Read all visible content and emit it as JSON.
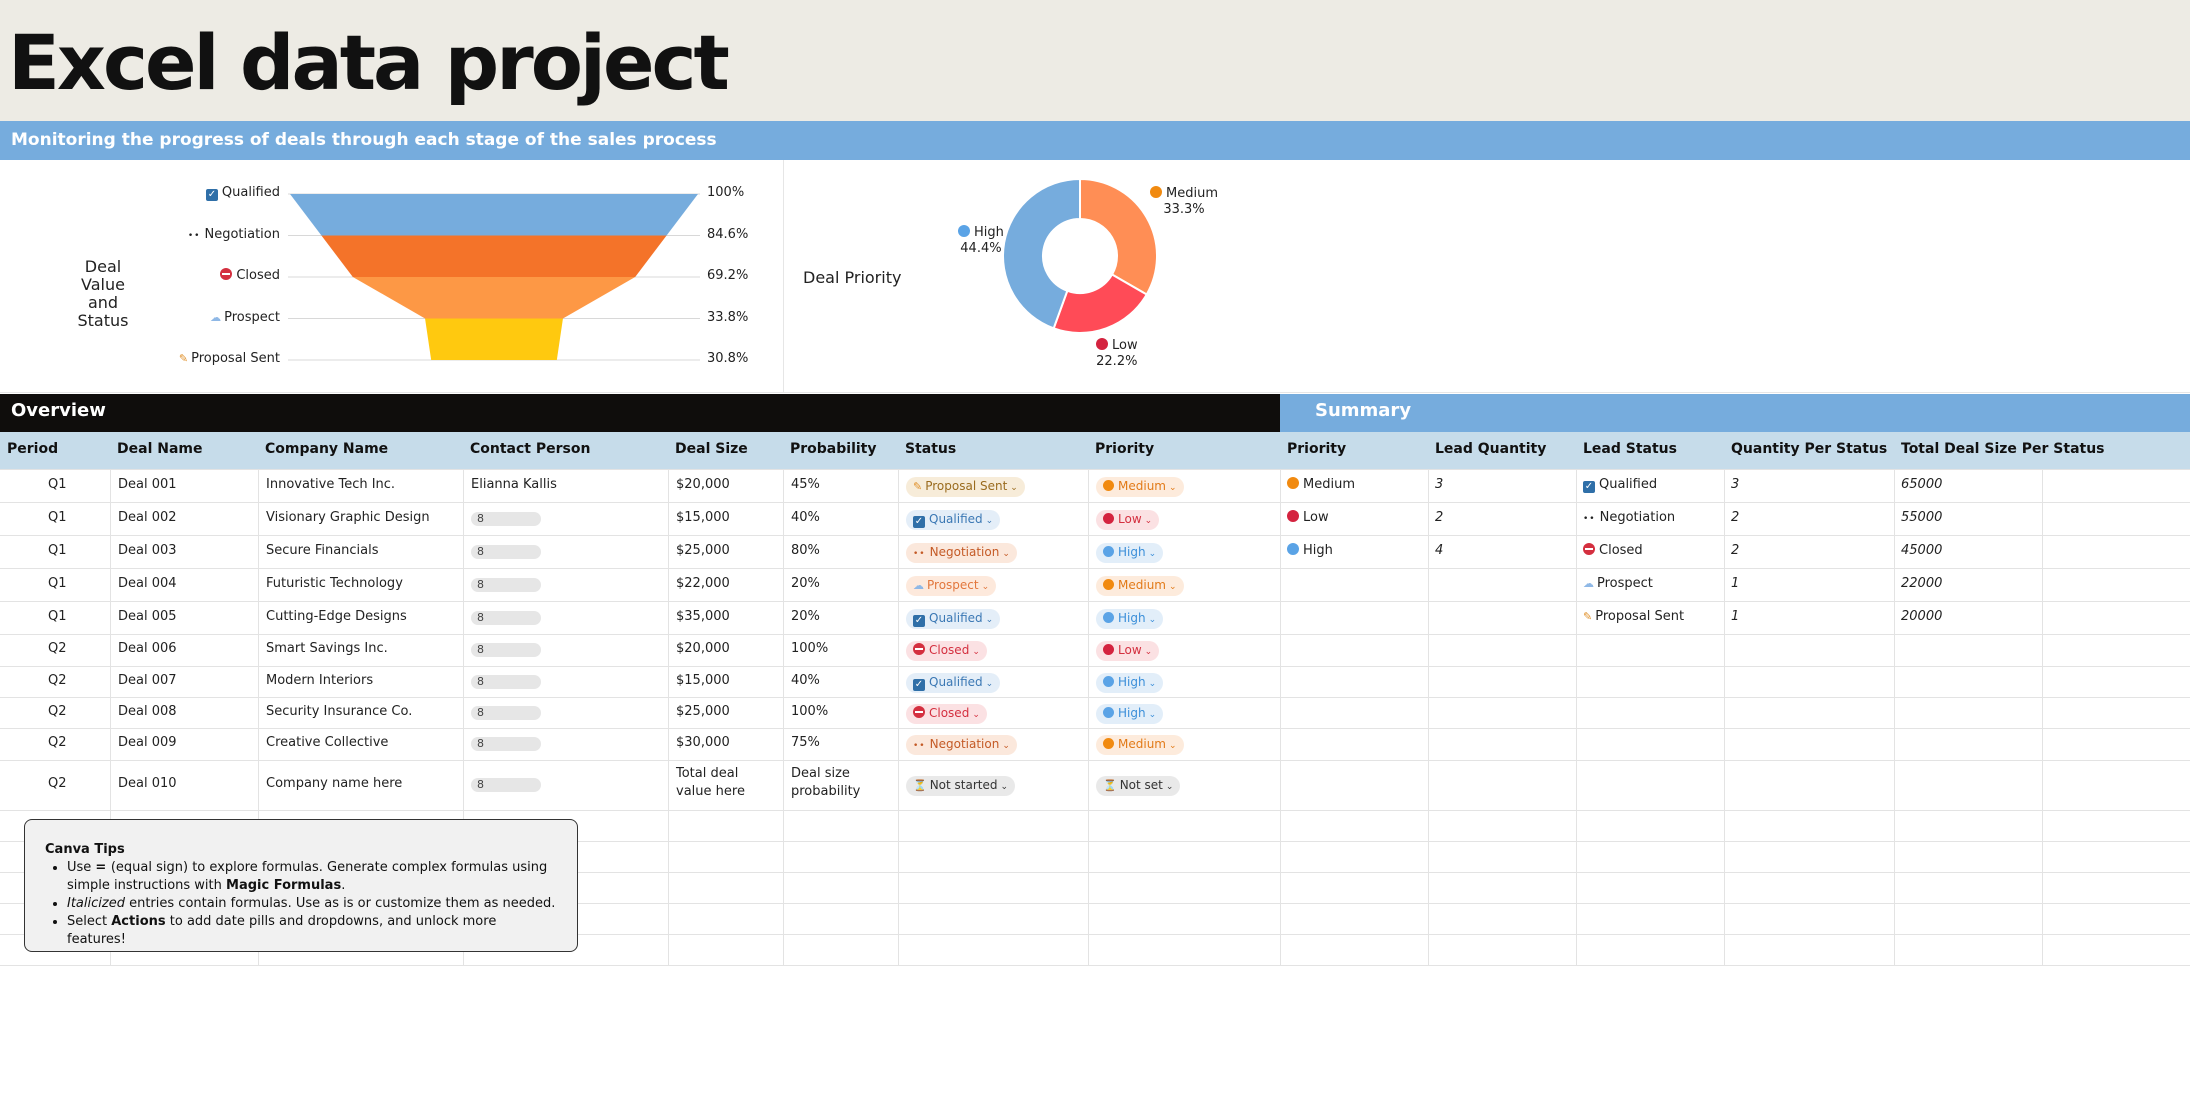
{
  "title": "Excel data project",
  "subtitle": "Monitoring the progress of deals through each stage of the sales process",
  "funnel": {
    "title_line1": "Deal Value",
    "title_line2": "and Status",
    "stages": [
      {
        "label": "Qualified",
        "pct": "100%",
        "color": "#76acdd",
        "icon": "check-icon",
        "value": 100
      },
      {
        "label": "Negotiation",
        "pct": "84.6%",
        "color": "#f47329",
        "icon": "eyes-icon",
        "value": 84.6
      },
      {
        "label": "Closed",
        "pct": "69.2%",
        "color": "#fd9845",
        "icon": "closed-icon",
        "value": 69.2
      },
      {
        "label": "Prospect",
        "pct": "33.8%",
        "color": "#ffc90f",
        "icon": "crystal-ball-icon",
        "value": 33.8
      },
      {
        "label": "Proposal Sent",
        "pct": "30.8%",
        "color": "#ffc90f",
        "icon": "pencil-icon",
        "value": 30.8
      }
    ]
  },
  "donut": {
    "title": "Deal Priority",
    "slices": [
      {
        "label": "Medium",
        "pct": "33.3%",
        "value": 33.3,
        "color": "#ff8e55",
        "dot": "#f18a10"
      },
      {
        "label": "Low",
        "pct": "22.2%",
        "value": 22.2,
        "color": "#ff4b57",
        "dot": "#d4233f"
      },
      {
        "label": "High",
        "pct": "44.4%",
        "value": 44.4,
        "color": "#76acdd",
        "dot": "#5aa3e6"
      }
    ]
  },
  "overview": {
    "title": "Overview",
    "columns": [
      "Period",
      "Deal Name",
      "Company Name",
      "Contact Person",
      "Deal Size",
      "Probability",
      "Status",
      "Priority"
    ],
    "rows": [
      {
        "period": "Q1",
        "deal": "Deal 001",
        "company": "Innovative Tech Inc.",
        "contact": "Elianna Kallis",
        "size": "$20,000",
        "prob": "45%",
        "status": "Proposal Sent",
        "status_kind": "proposal",
        "priority": "Medium",
        "priority_kind": "medium"
      },
      {
        "period": "Q1",
        "deal": "Deal 002",
        "company": "Visionary Graphic Design",
        "contact": "8",
        "size": "$15,000",
        "prob": "40%",
        "status": "Qualified",
        "status_kind": "qualified",
        "priority": "Low",
        "priority_kind": "low"
      },
      {
        "period": "Q1",
        "deal": "Deal 003",
        "company": "Secure Financials",
        "contact": "8",
        "size": "$25,000",
        "prob": "80%",
        "status": "Negotiation",
        "status_kind": "negotiation",
        "priority": "High",
        "priority_kind": "high"
      },
      {
        "period": "Q1",
        "deal": "Deal 004",
        "company": "Futuristic Technology",
        "contact": "8",
        "size": "$22,000",
        "prob": "20%",
        "status": "Prospect",
        "status_kind": "prospect",
        "priority": "Medium",
        "priority_kind": "medium"
      },
      {
        "period": "Q1",
        "deal": "Deal 005",
        "company": "Cutting-Edge Designs",
        "contact": "8",
        "size": "$35,000",
        "prob": "20%",
        "status": "Qualified",
        "status_kind": "qualified",
        "priority": "High",
        "priority_kind": "high"
      },
      {
        "period": "Q2",
        "deal": "Deal 006",
        "company": "Smart Savings Inc.",
        "contact": "8",
        "size": "$20,000",
        "prob": "100%",
        "status": "Closed",
        "status_kind": "closed",
        "priority": "Low",
        "priority_kind": "low"
      },
      {
        "period": "Q2",
        "deal": "Deal 007",
        "company": "Modern Interiors",
        "contact": "8",
        "size": "$15,000",
        "prob": "40%",
        "status": "Qualified",
        "status_kind": "qualified",
        "priority": "High",
        "priority_kind": "high"
      },
      {
        "period": "Q2",
        "deal": "Deal 008",
        "company": "Security Insurance Co.",
        "contact": "8",
        "size": "$25,000",
        "prob": "100%",
        "status": "Closed",
        "status_kind": "closed",
        "priority": "High",
        "priority_kind": "high"
      },
      {
        "period": "Q2",
        "deal": "Deal 009",
        "company": "Creative Collective",
        "contact": "8",
        "size": "$30,000",
        "prob": "75%",
        "status": "Negotiation",
        "status_kind": "negotiation",
        "priority": "Medium",
        "priority_kind": "medium"
      },
      {
        "period": "Q2",
        "deal": "Deal 010",
        "company": "Company name here",
        "contact": "8",
        "size": "Total deal value here",
        "prob": "Deal size probability",
        "status": "Not started",
        "status_kind": "grey",
        "priority": "Not set",
        "priority_kind": "grey"
      }
    ]
  },
  "summary": {
    "title": "Summary",
    "columns": [
      "Priority",
      "Lead Quantity",
      "Lead Status",
      "Quantity Per Status",
      "Total Deal Size Per Status"
    ],
    "priority_rows": [
      {
        "label": "Medium",
        "qty": "3",
        "dot": "#f18a10"
      },
      {
        "label": "Low",
        "qty": "2",
        "dot": "#d4233f"
      },
      {
        "label": "High",
        "qty": "4",
        "dot": "#5aa3e6"
      }
    ],
    "status_rows": [
      {
        "label": "Qualified",
        "icon": "check-icon",
        "qty": "3",
        "total": "65000"
      },
      {
        "label": "Negotiation",
        "icon": "eyes-icon",
        "qty": "2",
        "total": "55000"
      },
      {
        "label": "Closed",
        "icon": "closed-icon",
        "qty": "2",
        "total": "45000"
      },
      {
        "label": "Prospect",
        "icon": "crystal-ball-icon",
        "qty": "1",
        "total": "22000"
      },
      {
        "label": "Proposal Sent",
        "icon": "pencil-icon",
        "qty": "1",
        "total": "20000"
      }
    ]
  },
  "tips": {
    "title": "Canva Tips",
    "line1_a": "Use ",
    "line1_b": "= ",
    "line1_c": "(equal sign) to explore formulas. Generate complex formulas using simple instructions with ",
    "line1_d": "Magic Formulas",
    "line1_e": ".",
    "line2_a": "Italicized",
    "line2_b": " entries contain formulas. Use as is or customize them as needed.",
    "line3_a": "Select ",
    "line3_b": "Actions",
    "line3_c": " to add date pills and dropdowns, and unlock more features!"
  }
}
